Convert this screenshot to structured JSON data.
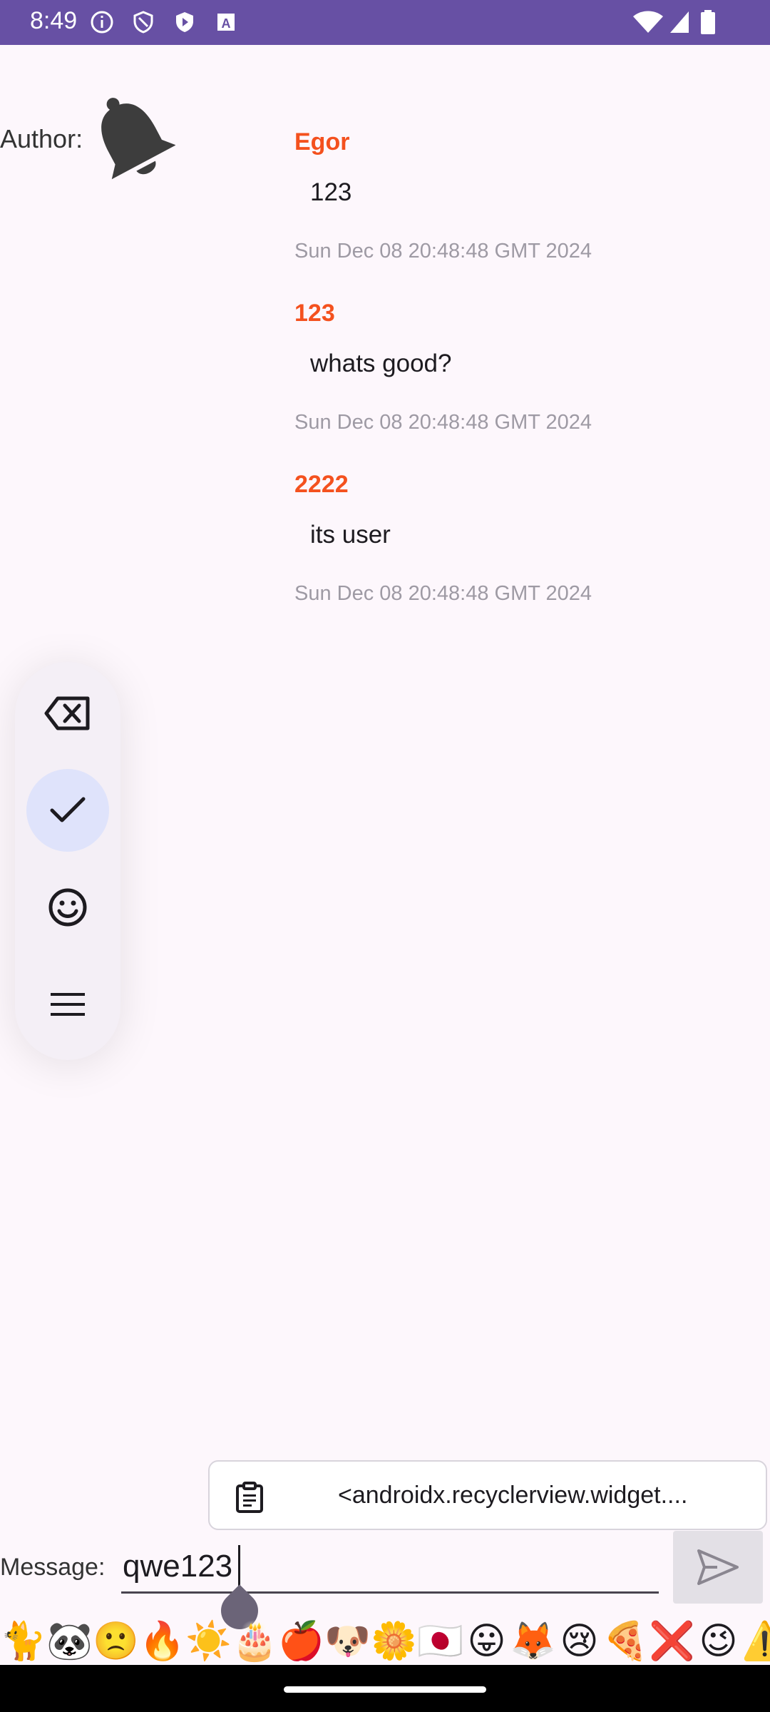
{
  "status_bar": {
    "time": "8:49",
    "icons": [
      "info-icon",
      "shield-icon",
      "play-store-icon",
      "a-font-icon",
      "wifi-icon",
      "signal-icon",
      "battery-icon"
    ],
    "color": "#6750a4"
  },
  "header": {
    "author_label": "Author:",
    "author_icon": "bell-icon"
  },
  "messages": [
    {
      "author": "Egor",
      "text": "123",
      "timestamp": "Sun Dec 08 20:48:48 GMT 2024"
    },
    {
      "author": "123",
      "text": "whats good?",
      "timestamp": "Sun Dec 08 20:48:48 GMT 2024"
    },
    {
      "author": "2222",
      "text": "its user",
      "timestamp": "Sun Dec 08 20:48:48 GMT 2024"
    }
  ],
  "toolbar": {
    "buttons": [
      "backspace-icon",
      "check-icon",
      "emoji-icon",
      "menu-icon"
    ],
    "active": "check-icon"
  },
  "clipboard_suggestion": {
    "text": "<androidx.recyclerview.widget...."
  },
  "composer": {
    "label": "Message:",
    "value": "qwe123",
    "send_icon": "send-icon"
  },
  "emoji_bar": {
    "emojis": [
      "🐈",
      "🐼",
      "🙁",
      "🔥",
      "☀️",
      "🎂",
      "🍎",
      "🐶",
      "🌼",
      "🇯🇵",
      "😛",
      "🦊",
      "😢",
      "🍕",
      "❌",
      "😉",
      "⚠️"
    ]
  },
  "colors": {
    "accent": "#6750a4",
    "author_name": "#f4511e",
    "timestamp": "#9e9aa4",
    "background": "#fdf7fc"
  }
}
